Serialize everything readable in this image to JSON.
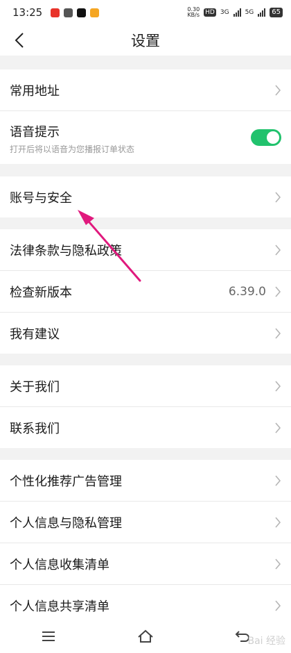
{
  "status": {
    "time": "13:25",
    "net_speed_value": "0.30",
    "net_speed_unit": "KB/s",
    "hd_badge": "HD",
    "sim1": "3G",
    "sim2": "5G",
    "battery": "65"
  },
  "header": {
    "title": "设置",
    "back_icon": "chevron-left-icon"
  },
  "groups": {
    "g1": {
      "address": {
        "label": "常用地址"
      },
      "voice": {
        "label": "语音提示",
        "sub": "打开后将以语音为您播报订单状态",
        "toggle_on": true,
        "toggle_color": "#21c26d"
      }
    },
    "g2": {
      "account": {
        "label": "账号与安全"
      }
    },
    "g3": {
      "legal": {
        "label": "法律条款与隐私政策"
      },
      "version": {
        "label": "检查新版本",
        "value": "6.39.0"
      },
      "feedback": {
        "label": "我有建议"
      }
    },
    "g4": {
      "about": {
        "label": "关于我们"
      },
      "contact": {
        "label": "联系我们"
      }
    },
    "g5": {
      "ads": {
        "label": "个性化推荐广告管理"
      },
      "privacy_mgmt": {
        "label": "个人信息与隐私管理"
      },
      "collect_list": {
        "label": "个人信息收集清单"
      },
      "share_list": {
        "label": "个人信息共享清单"
      }
    }
  },
  "annotation": {
    "color": "#e0197d",
    "target": "账号与安全"
  },
  "watermark": "Bai 经验",
  "colors": {
    "background": "#f2f2f2",
    "row_bg": "#ffffff",
    "accent_green": "#21c26d"
  }
}
